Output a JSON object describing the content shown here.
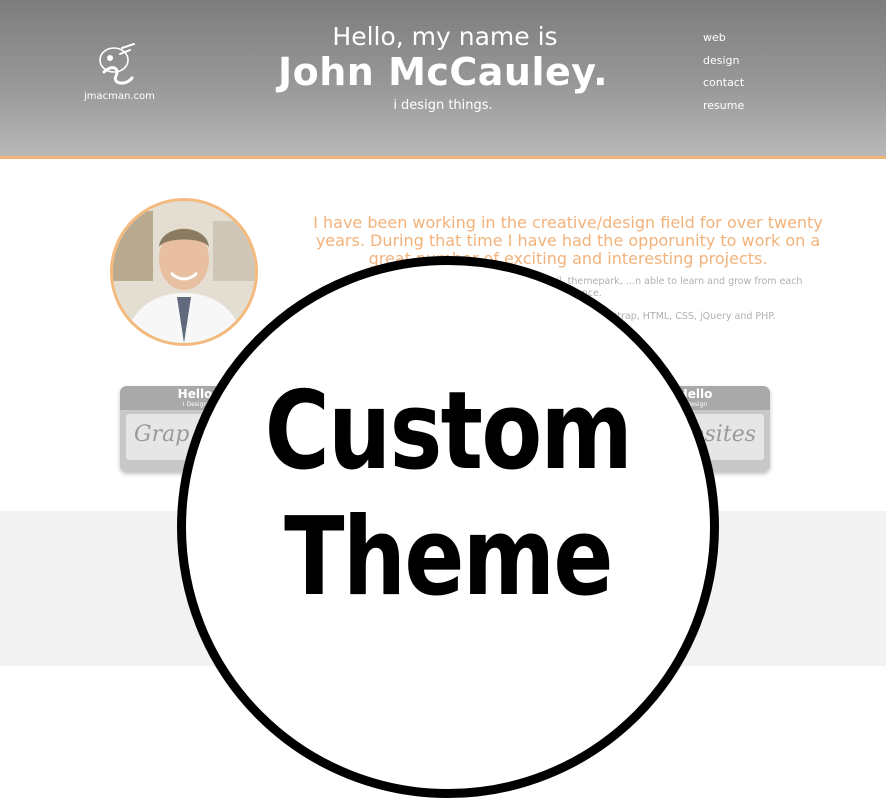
{
  "header": {
    "logo_text": "jmacman.com",
    "greeting_line1": "Hello, my name is",
    "greeting_name": "John McCauley.",
    "tagline": "i design things."
  },
  "nav": {
    "items": [
      {
        "label": "web"
      },
      {
        "label": "design"
      },
      {
        "label": "contact"
      },
      {
        "label": "resume"
      }
    ]
  },
  "intro": {
    "headline": "I have been working in the creative/design field for over twenty years. During that time I have had the opporunity to work on a great number of exciting and interesting projects.",
    "paragraph1": "…al, automotive, financial, fine jewelry, retail, themepark, …n able to learn and grow from each experience.",
    "paragraph2": "…for the past eight years. I have designed and …tstrap, HTML, CSS, jQuery and PHP."
  },
  "cards": [
    {
      "hello": "Hello",
      "sub": "I Design",
      "script": "Grap"
    },
    {
      "hello": "Hello",
      "sub": "I Design",
      "script": "bsites"
    }
  ],
  "overlay": {
    "line1": "Custom",
    "line2": "Theme"
  },
  "colors": {
    "accent_orange": "#f3b27a",
    "header_gray": "#8c8c8c",
    "badge_black": "#000000"
  }
}
